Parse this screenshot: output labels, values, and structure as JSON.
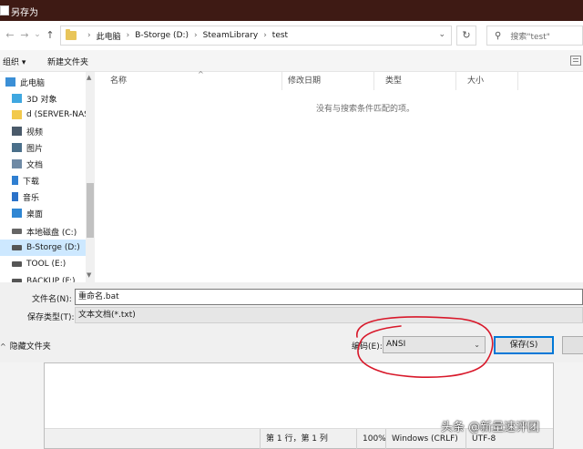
{
  "window": {
    "title": "另存为"
  },
  "address": {
    "breadcrumbs": [
      "此电脑",
      "B-Storge (D:)",
      "SteamLibrary",
      "test"
    ],
    "back_icon": "back-arrow-icon",
    "forward_icon": "forward-arrow-icon",
    "up_icon": "up-arrow-icon"
  },
  "search": {
    "placeholder": "搜索\"test\""
  },
  "toolbar": {
    "organize": "组织 ▾",
    "new_folder": "新建文件夹"
  },
  "sidebar": {
    "items": [
      {
        "label": "此电脑",
        "icon": "computer-icon",
        "color": "#3b8fd6"
      },
      {
        "label": "3D 对象",
        "icon": "cube-icon",
        "color": "#3fa7e0"
      },
      {
        "label": "d (SERVER-NAS",
        "icon": "network-drive-icon",
        "color": "#f2c94c"
      },
      {
        "label": "视频",
        "icon": "video-icon",
        "color": "#4a5a6a"
      },
      {
        "label": "图片",
        "icon": "picture-icon",
        "color": "#4a6f8a"
      },
      {
        "label": "文档",
        "icon": "document-icon",
        "color": "#6f8aa5"
      },
      {
        "label": "下载",
        "icon": "download-icon",
        "color": "#2f7fd1"
      },
      {
        "label": "音乐",
        "icon": "music-icon",
        "color": "#2b72c9"
      },
      {
        "label": "桌面",
        "icon": "desktop-icon",
        "color": "#2f86d3"
      },
      {
        "label": "本地磁盘 (C:)",
        "icon": "drive-icon",
        "color": "#666666"
      },
      {
        "label": "B-Storge (D:)",
        "icon": "drive-icon",
        "color": "#555555"
      },
      {
        "label": "TOOL (E:)",
        "icon": "drive-icon",
        "color": "#555555"
      },
      {
        "label": "BACKUP (F:)",
        "icon": "drive-icon",
        "color": "#555555"
      }
    ],
    "selected_index": 10
  },
  "list": {
    "columns": [
      "名称",
      "修改日期",
      "类型",
      "大小"
    ],
    "empty_message": "没有与搜索条件匹配的项。"
  },
  "form": {
    "filename_label": "文件名(N):",
    "filename_value": "重命名.bat",
    "filetype_label": "保存类型(T):",
    "filetype_value": "文本文档(*.txt)",
    "hide_folders": "隐藏文件夹",
    "encoding_label": "编码(E):",
    "encoding_value": "ANSI",
    "save": "保存(S)"
  },
  "notepad_status": {
    "position": "第 1 行，第 1 列",
    "zoom": "100%",
    "line_ending": "Windows (CRLF)",
    "encoding": "UTF-8"
  },
  "watermark": "头条 @新量速评团",
  "colors": {
    "titlebar": "#3e1a14",
    "annotation": "#d8182a",
    "accent": "#0078d7"
  }
}
